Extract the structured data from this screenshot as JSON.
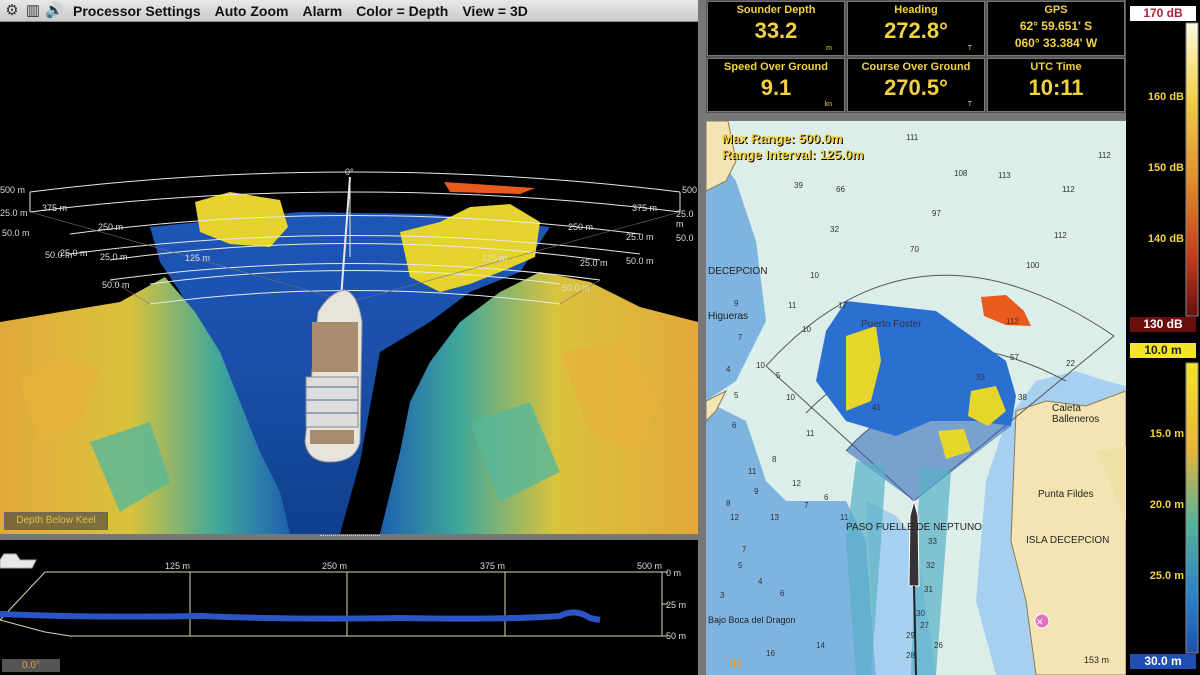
{
  "toolbar": {
    "icons": [
      "gear-icon",
      "panels-icon",
      "speaker-icon"
    ],
    "menus": [
      "Processor Settings",
      "Auto Zoom",
      "Alarm",
      "Color = Depth",
      "View = 3D"
    ]
  },
  "view3d": {
    "center_tick": "0°",
    "range_labels_left": [
      "500 m",
      "375 m",
      "250 m",
      "125 m"
    ],
    "range_labels_right": [
      "500",
      "375 m",
      "250 m",
      "125 m"
    ],
    "depth_labels_left": [
      "25.0 m",
      "50.0 m",
      "25.0 m",
      "50.0 m",
      "25.0 m",
      "50.0 m"
    ],
    "depth_labels_right": [
      "25.0 m",
      "50.0",
      "25.0 m",
      "50.0 m",
      "25.0 m",
      "50.0 m"
    ],
    "overlay_label": "Depth Below Keel"
  },
  "profile": {
    "range_ticks": [
      "125 m",
      "250 m",
      "375 m",
      "500 m"
    ],
    "depth_ticks": [
      "0 m",
      "25 m",
      "50 m"
    ],
    "heading_readout": "0.0°"
  },
  "instruments": [
    {
      "label": "Sounder Depth",
      "value": "33.2",
      "unit": "m"
    },
    {
      "label": "Heading",
      "value": "272.8°",
      "unit": "T"
    },
    {
      "label": "GPS",
      "value_line1": "62° 59.651' S",
      "value_line2": "060° 33.384' W"
    },
    {
      "label": "Speed Over Ground",
      "value": "9.1",
      "unit": "kn"
    },
    {
      "label": "Course Over Ground",
      "value": "270.5°",
      "unit": "T"
    },
    {
      "label": "UTC Time",
      "value": "10:11"
    }
  ],
  "chart": {
    "max_range": "Max Range: 500.0m",
    "range_interval": "Range Interval: 125.0m",
    "place_names": [
      "DECEPCION",
      "Higueras",
      "Puerto Foster",
      "Caleta Balleneros",
      "Punta Fildes",
      "ISLA DECEPCION",
      "PASO FUELLE DE NEPTUNO",
      "Bajo Boca del Dragon"
    ],
    "scale_text": "153 m",
    "soundings": [
      "111",
      "112",
      "39",
      "66",
      "108",
      "113",
      "112",
      "97",
      "112",
      "32",
      "70",
      "100",
      "10",
      "11",
      "17",
      "112",
      "9",
      "7",
      "10",
      "57",
      "22",
      "33",
      "38",
      "41",
      "5",
      "4",
      "10",
      "5",
      "6",
      "10",
      "11",
      "8",
      "11",
      "12",
      "9",
      "8",
      "7",
      "6",
      "11",
      "13",
      "12",
      "7",
      "33",
      "32",
      "31",
      "30",
      "29",
      "28",
      "27",
      "26",
      "5",
      "4",
      "6",
      "3",
      "14",
      "16"
    ]
  },
  "colorbar": {
    "db_top": "170 dB",
    "db_ticks": [
      "160 dB",
      "150 dB",
      "140 dB"
    ],
    "db_bottom": "130 dB",
    "depth_top": "10.0 m",
    "depth_ticks": [
      "15.0 m",
      "20.0 m",
      "25.0 m"
    ],
    "depth_bottom": "30.0 m"
  }
}
